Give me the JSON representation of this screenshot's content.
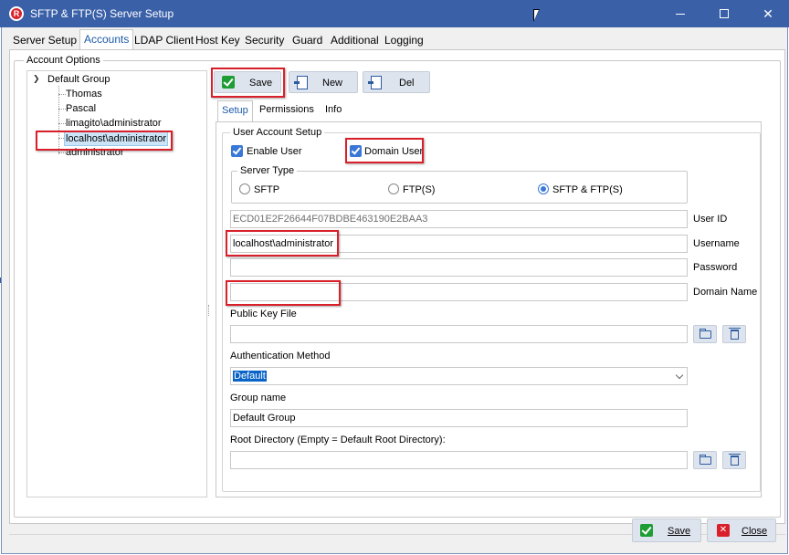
{
  "window": {
    "title": "SFTP & FTP(S) Server Setup",
    "app_icon_letter": "R"
  },
  "tabs": [
    {
      "label": "Server Setup"
    },
    {
      "label": "Accounts"
    },
    {
      "label": "LDAP Client"
    },
    {
      "label": "Host Key"
    },
    {
      "label": "Security"
    },
    {
      "label": "Guard"
    },
    {
      "label": "Additional"
    },
    {
      "label": "Logging"
    }
  ],
  "account_options": {
    "label": "Account Options",
    "tree": {
      "root": "Default Group",
      "children": [
        "Thomas",
        "Pascal",
        "limagito\\administrator",
        "localhost\\administrator",
        "administrator"
      ]
    }
  },
  "toolbar": {
    "save": "Save",
    "new": "New",
    "del": "Del"
  },
  "subtabs": [
    {
      "label": "Setup"
    },
    {
      "label": "Permissions"
    },
    {
      "label": "Info"
    }
  ],
  "setup": {
    "group_label": "User Account Setup",
    "enable_user": "Enable User",
    "domain_user": "Domain User",
    "server_type": {
      "label": "Server Type",
      "options": [
        "SFTP",
        "FTP(S)",
        "SFTP & FTP(S)"
      ],
      "selected": "SFTP & FTP(S)"
    },
    "user_id": {
      "label": "User ID",
      "value": "ECD01E2F26644F07BDBE463190E2BAA3"
    },
    "username": {
      "label": "Username",
      "value": "localhost\\administrator"
    },
    "password": {
      "label": "Password",
      "value": ""
    },
    "domain_name": {
      "label": "Domain Name",
      "value": ""
    },
    "public_key_file": {
      "label": "Public Key File",
      "value": ""
    },
    "auth_method": {
      "label": "Authentication Method",
      "value": "Default"
    },
    "group_name": {
      "label": "Group name",
      "value": "Default Group"
    },
    "root_directory": {
      "label": "Root Directory (Empty = Default Root Directory):",
      "value": ""
    }
  },
  "footer": {
    "save": "Save",
    "close": "Close"
  },
  "colors": {
    "titlebar": "#3a60a8",
    "highlight_box": "#d9202a",
    "accent": "#3a78d8"
  }
}
